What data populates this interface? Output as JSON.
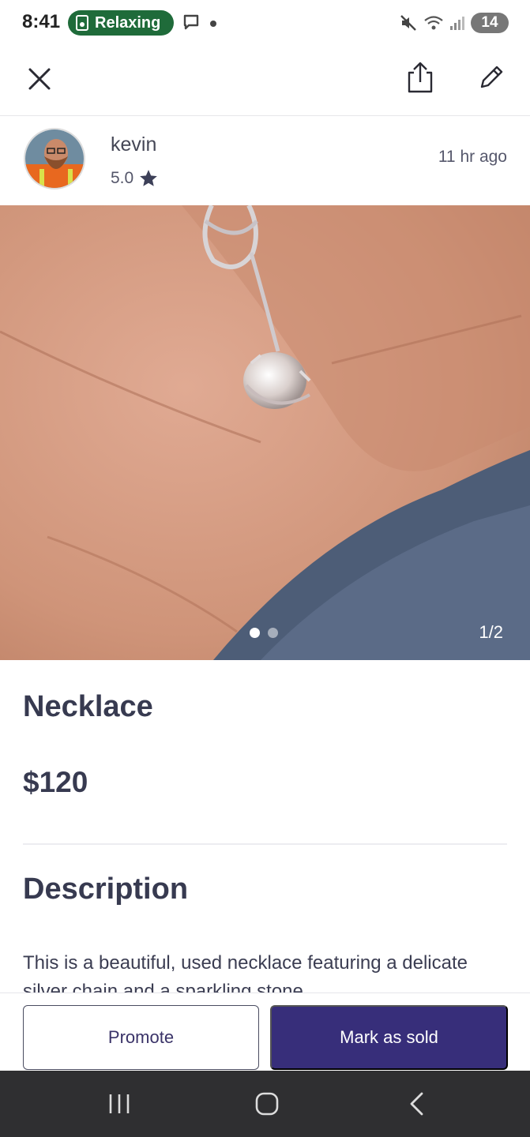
{
  "status_bar": {
    "time": "8:41",
    "focus_mode": "Relaxing",
    "battery": "14",
    "icons": [
      "message-icon",
      "dot-icon",
      "mute-icon",
      "wifi-icon",
      "signal-icon",
      "battery-icon"
    ]
  },
  "header": {
    "icons": [
      "close-icon",
      "share-icon",
      "edit-icon"
    ]
  },
  "seller": {
    "name": "kevin",
    "rating": "5.0",
    "posted": "11 hr  ago"
  },
  "photo": {
    "counter": "1/2",
    "total": 2,
    "current": 1
  },
  "listing": {
    "title": "Necklace",
    "price": "$120",
    "description_heading": "Description",
    "description": "This is a beautiful, used necklace featuring a delicate silver chain and a sparkling stone"
  },
  "actions": {
    "promote": "Promote",
    "mark_sold": "Mark as sold"
  },
  "colors": {
    "primary": "#372e7a",
    "focus_pill": "#1f6b3a",
    "text": "#373a50"
  }
}
